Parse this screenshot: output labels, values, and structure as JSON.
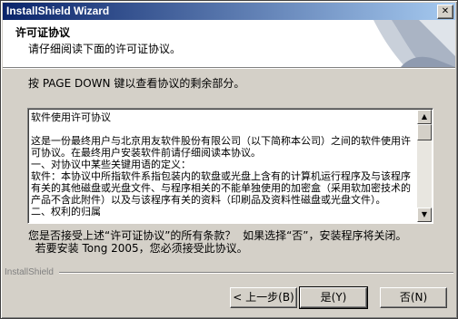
{
  "window": {
    "title": "InstallShield Wizard"
  },
  "header": {
    "title": "许可证协议",
    "subtitle": "请仔细阅读下面的许可证协议。"
  },
  "instruction": "按 PAGE DOWN 键以查看协议的剩余部分。",
  "license": {
    "text": "软件使用许可协议\n\n这是一份最终用户与北京用友软件股份有限公司（以下简称本公司）之间的软件使用许可协议。在最终用户安装软件前请仔细阅读本协议。\n一、对协议中某些关键用语的定义：\n软件：本协议中所指软件系指包装内的软盘或光盘上含有的计算机运行程序及与该程序有关的其他磁盘或光盘文件、与程序相关的不能单独使用的加密盒（采用软加密技术的产品不含此附件）以及与该程序有关的资料（印刷品及资料性磁盘或光盘文件）。\n二、权利的归属"
  },
  "question": "您是否接受上述“许可证协议”的所有条款？  如果选择“否”，安装程序将关闭。\n  若要安装 Tong 2005，您必须接受此协议。",
  "brand": "InstallShield",
  "buttons": {
    "back": "< 上一步(B)",
    "yes": "是(Y)",
    "no": "否(N)"
  },
  "icons": {
    "close": "close-icon",
    "scroll_up": "arrow-up-icon",
    "scroll_down": "arrow-down-icon"
  },
  "colors": {
    "title_start": "#0a246a",
    "title_end": "#a6caf0",
    "face": "#d4d0c8"
  }
}
